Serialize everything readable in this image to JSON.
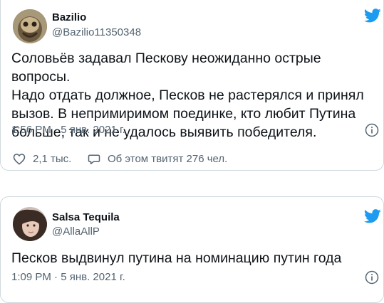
{
  "tweets": [
    {
      "author": {
        "name": "Bazilio",
        "handle": "@Bazilio11350348"
      },
      "text": "Соловьёв задавал Пескову неожиданно острые вопросы.\nНадо отдать должное, Песков не растерялся и принял\nвызов. В непримиримом поединке, кто любит Путина\nбольше, так и не удалось выявить победителя.",
      "timestamp": "1:56 PM · 5 янв. 2021 г.",
      "likes": "2,1 тыс.",
      "discussion": "Об этом твитят 276 чел."
    },
    {
      "author": {
        "name": "Salsa Tequila",
        "handle": "@AllaAllP"
      },
      "text": "Песков выдвинул путина на номинацию путин года",
      "timestamp": "1:09 PM · 5 янв. 2021 г."
    }
  ],
  "colors": {
    "brand": "#1d9bf0",
    "secondary_text": "#536471",
    "border": "#cfd9de"
  },
  "icons": [
    "twitter-bird-icon",
    "info-icon",
    "heart-icon",
    "speech-bubble-icon"
  ]
}
